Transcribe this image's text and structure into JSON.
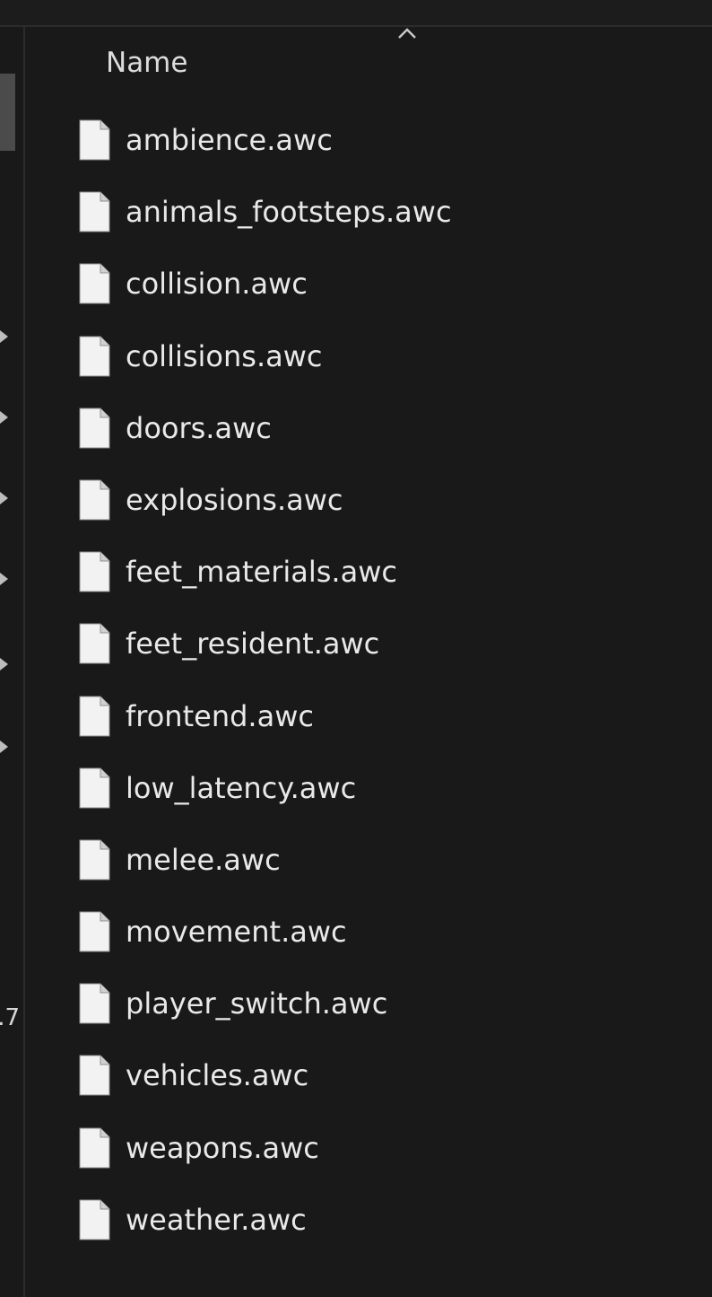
{
  "header": {
    "name_column": "Name"
  },
  "nav_pane": {
    "cut_text": "7."
  },
  "files": [
    {
      "name": "ambience.awc",
      "icon": "file-icon"
    },
    {
      "name": "animals_footsteps.awc",
      "icon": "file-icon"
    },
    {
      "name": "collision.awc",
      "icon": "file-icon"
    },
    {
      "name": "collisions.awc",
      "icon": "file-icon"
    },
    {
      "name": "doors.awc",
      "icon": "file-icon"
    },
    {
      "name": "explosions.awc",
      "icon": "file-icon"
    },
    {
      "name": "feet_materials.awc",
      "icon": "file-icon"
    },
    {
      "name": "feet_resident.awc",
      "icon": "file-icon"
    },
    {
      "name": "frontend.awc",
      "icon": "file-icon"
    },
    {
      "name": "low_latency.awc",
      "icon": "file-icon"
    },
    {
      "name": "melee.awc",
      "icon": "file-icon"
    },
    {
      "name": "movement.awc",
      "icon": "file-icon"
    },
    {
      "name": "player_switch.awc",
      "icon": "file-icon"
    },
    {
      "name": "vehicles.awc",
      "icon": "file-icon"
    },
    {
      "name": "weapons.awc",
      "icon": "file-icon"
    },
    {
      "name": "weather.awc",
      "icon": "file-icon"
    }
  ],
  "colors": {
    "background": "#191919",
    "text": "#e9e9e9",
    "icon_fill": "#f2f2f2",
    "divider": "#2b2b2b"
  }
}
